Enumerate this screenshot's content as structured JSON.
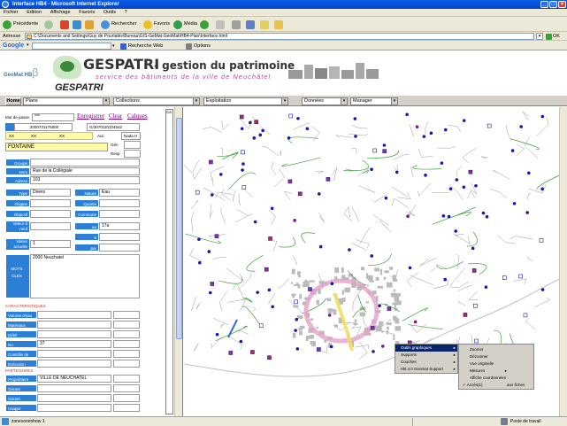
{
  "window": {
    "title": "Interface HB4 - Microsoft Internet Explorer",
    "min_label": "_",
    "max_label": "□",
    "close_label": "×"
  },
  "menubar": [
    "Fichier",
    "Edition",
    "Affichage",
    "Favoris",
    "Outils",
    "?"
  ],
  "toolbar": {
    "back_label": "Précédente",
    "search_label": "Rechercher",
    "favorites_label": "Favoris",
    "media_label": "Média"
  },
  "addressbar": {
    "label": "Adresse",
    "url": "C:\\Documents and Settings\\Guy de Pourtalès\\Bureau\\GIS-GeMat-GeoMat\\HB4-Plan\\Interface.html",
    "go_label": "OK"
  },
  "googlebar": {
    "brand": "Google",
    "web_search_label": "Recherche Web",
    "options_label": "Options"
  },
  "header": {
    "app_name": "GESPATRI",
    "app_tagline": "- gestion du patrimoine",
    "subtitle": "service des bâtiments de la ville de Neuchâtel",
    "logo_text": "GeoMat HB",
    "logo_beta": "β",
    "app_name_bottom": "GESPATRI"
  },
  "navbar": {
    "home_label": "Home",
    "menus": [
      "Plans",
      "Collections",
      "Exploitation",
      "Données",
      "Manager"
    ]
  },
  "form": {
    "mot_de_passe_label": "Mot de passe",
    "mot_de_passe_value": "***",
    "links": [
      "Enregistrer",
      "Clear",
      "Calques"
    ],
    "id_value": "2000731175800",
    "code_value": "G/3070110104642",
    "row_xx": [
      "XX",
      "XX",
      "XX"
    ],
    "aut_label": "Aut.",
    "aut_value": "Nada H",
    "gen_label": "Gén",
    "resp_label": "Resp",
    "name_value": "FONTAINE",
    "groupe_label": "Groupe",
    "nom_label": "Nom",
    "nom_value": "Rue de la Collégiale",
    "adresse_label": "Adress",
    "adresse_value": "103",
    "type_label": "Type",
    "type_value": "Divers",
    "nature_label": "Nature",
    "nature_value": "Eau",
    "origine_label": "Origine",
    "quartier_label": "Quartie",
    "objectif_label": "Objectif",
    "commune_label": "Commune",
    "valeur_label": "Valeur à neuf",
    "au_label": "au",
    "au_value": "17a",
    "valeur_actuelle_label": "Valeur actuelle",
    "valeur_actuelle_value": "1",
    "pour_label": "par",
    "mots_cles_label": "MOTS CLES",
    "mots_cles_value": "2000 Neuchatel",
    "section_caracteristiques": "CARACTERISTIQUES",
    "carac_rows": [
      {
        "label": "Volume d'eau",
        "value": ""
      },
      {
        "label": "Matériaux bassin",
        "value": ""
      },
      {
        "label": "Débit",
        "value": ""
      },
      {
        "label": "No",
        "value": "37"
      },
      {
        "label": "Contrôle de qualité",
        "value": ""
      },
      {
        "label": "Exécution",
        "value": ""
      }
    ],
    "section_partenaires": "PARTENAIRES",
    "part_rows": [
      {
        "label": "Propriétaire",
        "value": "VILLE DE NEUCHATEL"
      },
      {
        "label": "Gérant",
        "value": ""
      },
      {
        "label": "Gérant",
        "value": ""
      },
      {
        "label": "Usager",
        "value": ""
      }
    ]
  },
  "context_menu": {
    "items": [
      "Outils graphiques",
      "Supports",
      "Couches",
      "HB 4.0 Geomat Support"
    ],
    "sub_items": [
      "Zoomer",
      "Dézoomer",
      "Vue originelle",
      "Mesures",
      "Affiche coordonnées",
      "Accès(1)"
    ],
    "sub_extra": "aux fiches"
  },
  "statusbar": {
    "left_text": "zonesoneshow 1",
    "right_text": "Poste de travail"
  },
  "colors": {
    "xp_blue": "#0a5ee8",
    "label_blue": "#2c7fd6",
    "link_purple": "#800080",
    "dot_blue": "#1a1aa8",
    "dot_purple": "#7a1a8a",
    "street_green": "#3aa23a"
  }
}
